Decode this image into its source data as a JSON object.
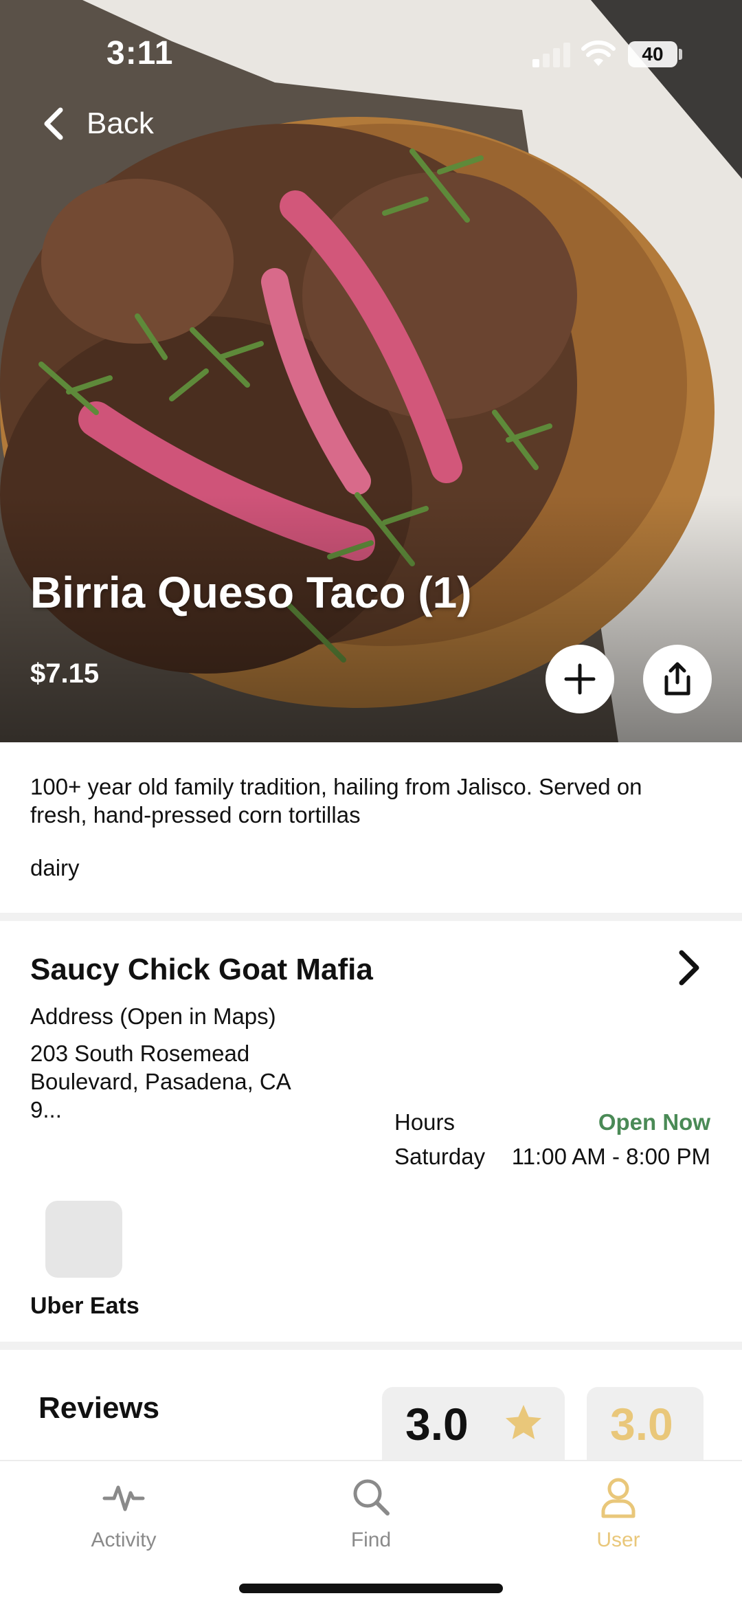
{
  "status": {
    "time": "3:11",
    "battery": "40"
  },
  "nav": {
    "back_label": "Back"
  },
  "item": {
    "title": "Birria Queso Taco (1)",
    "price": "$7.15",
    "description": "100+ year old family tradition, hailing from Jalisco. Served on fresh, hand-pressed corn tortillas",
    "tag": "dairy"
  },
  "vendor": {
    "name": "Saucy Chick Goat Mafia",
    "address_label": "Address (Open in Maps)",
    "address": "203 South Rosemead Boulevard, Pasadena, CA 9...",
    "hours_label": "Hours",
    "open_status": "Open Now",
    "hours_day": "Saturday",
    "hours_time": "11:00 AM - 8:00 PM",
    "delivery_partner": "Uber Eats"
  },
  "reviews": {
    "title": "Reviews",
    "rating_primary": "3.0",
    "rating_secondary": "3.0"
  },
  "tabs": [
    {
      "label": "Activity",
      "icon": "activity-icon"
    },
    {
      "label": "Find",
      "icon": "search-icon"
    },
    {
      "label": "User",
      "icon": "user-icon",
      "active": true
    }
  ],
  "colors": {
    "accent": "#e9c77a",
    "open_green": "#4a8a56",
    "divider": "#f1f1f1"
  }
}
